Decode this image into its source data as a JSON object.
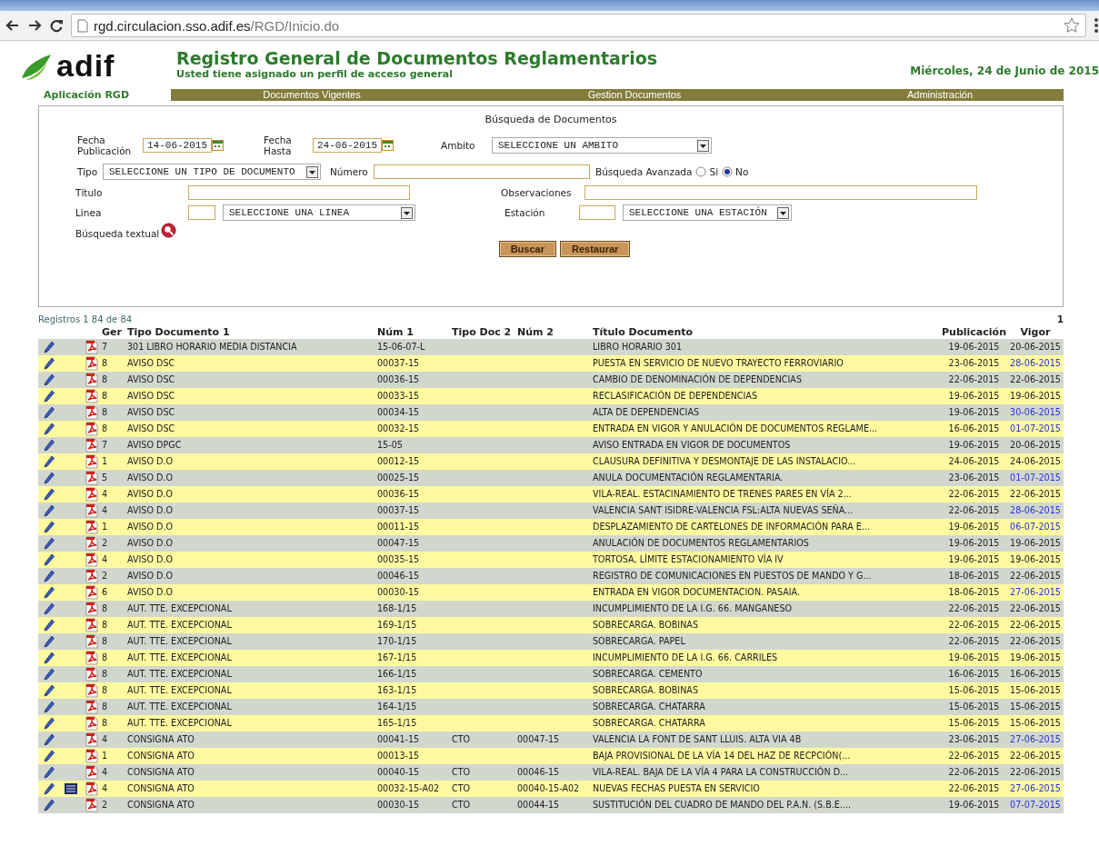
{
  "browser": {
    "url_host": "rgd.circulacion.sso.adif.es",
    "url_path": "/RGD/Inicio.do"
  },
  "header": {
    "logo": "adif",
    "title": "Registro General de Documentos Reglamentarios",
    "subtitle": "Usted tiene asignado un perfil de acceso general",
    "date": "Miércoles, 24 de Junio de 2015",
    "app_label": "Aplicación RGD",
    "menu": [
      "Documentos Vigentes",
      "Gestion Documentos",
      "Administración"
    ]
  },
  "search": {
    "title": "Búsqueda de Documentos",
    "fecha_publicacion": {
      "label": "Fecha Publicación",
      "value": "14-06-2015"
    },
    "fecha_hasta": {
      "label": "Fecha Hasta",
      "value": "24-06-2015"
    },
    "ambito": {
      "label": "Ambito",
      "value": "SELECCIONE UN AMBITO"
    },
    "tipo": {
      "label": "Tipo",
      "value": "SELECCIONE UN TIPO DE DOCUMENTO"
    },
    "numero": {
      "label": "Número"
    },
    "avanzada": {
      "label": "Búsqueda Avanzada",
      "options": [
        {
          "label": "Si",
          "selected": false
        },
        {
          "label": "No",
          "selected": true
        }
      ]
    },
    "titulo": {
      "label": "Título"
    },
    "observaciones": {
      "label": "Observaciones"
    },
    "linea": {
      "label": "Linea",
      "value": "SELECCIONE UNA LINEA"
    },
    "estacion": {
      "label": "Estación",
      "value": "SELECCIONE UNA ESTACIÓN"
    },
    "textual": {
      "label": "Búsqueda textual"
    },
    "buttons": [
      "Buscar",
      "Restaurar"
    ]
  },
  "results": {
    "count": "Registros 1 84 de 84",
    "page": "1",
    "columns": [
      "Ger",
      "Tipo Documento 1",
      "Núm 1",
      "Tipo Doc 2",
      "Núm 2",
      "Título Documento",
      "Publicación",
      "Vigor"
    ],
    "rows": [
      {
        "ger": "7",
        "tipo1": "301 LIBRO HORARIO MEDIA DISTANCIA",
        "num1": "15-06-07-L",
        "titulo": "LIBRO HORARIO 301",
        "publicacion": "19-06-2015",
        "vigor": "20-06-2015",
        "vigor_pending": false,
        "detail": false
      },
      {
        "ger": "8",
        "tipo1": "AVISO DSC",
        "num1": "00037-15",
        "titulo": "PUESTA EN SERVICIO DE NUEVO TRAYECTO FERROVIARIO",
        "publicacion": "23-06-2015",
        "vigor": "28-06-2015",
        "vigor_pending": true,
        "detail": false
      },
      {
        "ger": "8",
        "tipo1": "AVISO DSC",
        "num1": "00036-15",
        "titulo": "CAMBIO DE DENOMINACIÓN DE DEPENDENCIAS",
        "publicacion": "22-06-2015",
        "vigor": "22-06-2015",
        "vigor_pending": false,
        "detail": false
      },
      {
        "ger": "8",
        "tipo1": "AVISO DSC",
        "num1": "00033-15",
        "titulo": "RECLASIFICACIÓN DE DEPENDENCIAS",
        "publicacion": "19-06-2015",
        "vigor": "19-06-2015",
        "vigor_pending": false,
        "detail": false
      },
      {
        "ger": "8",
        "tipo1": "AVISO DSC",
        "num1": "00034-15",
        "titulo": "ALTA DE DEPENDENCIAS",
        "publicacion": "19-06-2015",
        "vigor": "30-06-2015",
        "vigor_pending": true,
        "detail": false
      },
      {
        "ger": "8",
        "tipo1": "AVISO DSC",
        "num1": "00032-15",
        "titulo": "ENTRADA EN VIGOR Y ANULACIÓN DE DOCUMENTOS REGLAME...",
        "publicacion": "16-06-2015",
        "vigor": "01-07-2015",
        "vigor_pending": true,
        "detail": false
      },
      {
        "ger": "7",
        "tipo1": "AVISO DPGC",
        "num1": "15-05",
        "titulo": "AVISO ENTRADA EN VIGOR DE DOCUMENTOS",
        "publicacion": "19-06-2015",
        "vigor": "20-06-2015",
        "vigor_pending": false,
        "detail": false
      },
      {
        "ger": "1",
        "tipo1": "AVISO D.O",
        "num1": "00012-15",
        "titulo": "CLAUSURA DEFINITIVA Y DESMONTAJE DE LAS INSTALACIO...",
        "publicacion": "24-06-2015",
        "vigor": "24-06-2015",
        "vigor_pending": false,
        "detail": false
      },
      {
        "ger": "5",
        "tipo1": "AVISO D.O",
        "num1": "00025-15",
        "titulo": "ANULA DOCUMENTACIÓN REGLAMENTARIA.",
        "publicacion": "23-06-2015",
        "vigor": "01-07-2015",
        "vigor_pending": true,
        "detail": false
      },
      {
        "ger": "4",
        "tipo1": "AVISO D.O",
        "num1": "00036-15",
        "titulo": "VILA-REAL. ESTACINAMIENTO DE TRENES PARES EN VÍA 2...",
        "publicacion": "22-06-2015",
        "vigor": "22-06-2015",
        "vigor_pending": false,
        "detail": false
      },
      {
        "ger": "4",
        "tipo1": "AVISO D.O",
        "num1": "00037-15",
        "titulo": "VALENCIA SANT ISIDRE-VALENCIA FSL:ALTA NUEVAS SEÑA...",
        "publicacion": "22-06-2015",
        "vigor": "28-06-2015",
        "vigor_pending": true,
        "detail": false
      },
      {
        "ger": "1",
        "tipo1": "AVISO D.O",
        "num1": "00011-15",
        "titulo": "DESPLAZAMIENTO DE CARTELONES DE INFORMACIÓN PARA E...",
        "publicacion": "19-06-2015",
        "vigor": "06-07-2015",
        "vigor_pending": true,
        "detail": false
      },
      {
        "ger": "2",
        "tipo1": "AVISO D.O",
        "num1": "00047-15",
        "titulo": "ANULACIÓN DE DOCUMENTOS REGLAMENTARIOS",
        "publicacion": "19-06-2015",
        "vigor": "19-06-2015",
        "vigor_pending": false,
        "detail": false
      },
      {
        "ger": "4",
        "tipo1": "AVISO D.O",
        "num1": "00035-15",
        "titulo": "TORTOSA, LÍMITE ESTACIONAMIENTO VÍA IV",
        "publicacion": "19-06-2015",
        "vigor": "19-06-2015",
        "vigor_pending": false,
        "detail": false
      },
      {
        "ger": "2",
        "tipo1": "AVISO D.O",
        "num1": "00046-15",
        "titulo": "REGISTRO DE COMUNICACIONES EN PUESTOS DE MANDO Y G...",
        "publicacion": "18-06-2015",
        "vigor": "22-06-2015",
        "vigor_pending": false,
        "detail": false
      },
      {
        "ger": "6",
        "tipo1": "AVISO D.O",
        "num1": "00030-15",
        "titulo": "ENTRADA EN VIGOR DOCUMENTACION. PASAIA.",
        "publicacion": "18-06-2015",
        "vigor": "27-06-2015",
        "vigor_pending": true,
        "detail": false
      },
      {
        "ger": "8",
        "tipo1": "AUT. TTE. EXCEPCIONAL",
        "num1": "168-1/15",
        "titulo": "INCUMPLIMIENTO DE LA I.G. 66. MANGANESO",
        "publicacion": "22-06-2015",
        "vigor": "22-06-2015",
        "vigor_pending": false,
        "detail": false
      },
      {
        "ger": "8",
        "tipo1": "AUT. TTE. EXCEPCIONAL",
        "num1": "169-1/15",
        "titulo": "SOBRECARGA. BOBINAS",
        "publicacion": "22-06-2015",
        "vigor": "22-06-2015",
        "vigor_pending": false,
        "detail": false
      },
      {
        "ger": "8",
        "tipo1": "AUT. TTE. EXCEPCIONAL",
        "num1": "170-1/15",
        "titulo": "SOBRECARGA. PAPEL",
        "publicacion": "22-06-2015",
        "vigor": "22-06-2015",
        "vigor_pending": false,
        "detail": false
      },
      {
        "ger": "8",
        "tipo1": "AUT. TTE. EXCEPCIONAL",
        "num1": "167-1/15",
        "titulo": "INCUMPLIMIENTO DE LA I.G. 66. CARRILES",
        "publicacion": "19-06-2015",
        "vigor": "19-06-2015",
        "vigor_pending": false,
        "detail": false
      },
      {
        "ger": "8",
        "tipo1": "AUT. TTE. EXCEPCIONAL",
        "num1": "166-1/15",
        "titulo": "SOBRECARGA. CEMENTO",
        "publicacion": "16-06-2015",
        "vigor": "16-06-2015",
        "vigor_pending": false,
        "detail": false
      },
      {
        "ger": "8",
        "tipo1": "AUT. TTE. EXCEPCIONAL",
        "num1": "163-1/15",
        "titulo": "SOBRECARGA. BOBINAS",
        "publicacion": "15-06-2015",
        "vigor": "15-06-2015",
        "vigor_pending": false,
        "detail": false
      },
      {
        "ger": "8",
        "tipo1": "AUT. TTE. EXCEPCIONAL",
        "num1": "164-1/15",
        "titulo": "SOBRECARGA. CHATARRA",
        "publicacion": "15-06-2015",
        "vigor": "15-06-2015",
        "vigor_pending": false,
        "detail": false
      },
      {
        "ger": "8",
        "tipo1": "AUT. TTE. EXCEPCIONAL",
        "num1": "165-1/15",
        "titulo": "SOBRECARGA. CHATARRA",
        "publicacion": "15-06-2015",
        "vigor": "15-06-2015",
        "vigor_pending": false,
        "detail": false
      },
      {
        "ger": "4",
        "tipo1": "CONSIGNA ATO",
        "num1": "00041-15",
        "tipo2": "CTO",
        "num2": "00047-15",
        "titulo": "VALENCIA LA FONT DE SANT LLUIS. ALTA VIA 4B",
        "publicacion": "23-06-2015",
        "vigor": "27-06-2015",
        "vigor_pending": true,
        "detail": false
      },
      {
        "ger": "1",
        "tipo1": "CONSIGNA ATO",
        "num1": "00013-15",
        "titulo": "BAJA PROVISIONAL DE LA VÍA 14 DEL HAZ DE RECPCIÓN(...",
        "publicacion": "22-06-2015",
        "vigor": "22-06-2015",
        "vigor_pending": false,
        "detail": false
      },
      {
        "ger": "4",
        "tipo1": "CONSIGNA ATO",
        "num1": "00040-15",
        "tipo2": "CTO",
        "num2": "00046-15",
        "titulo": "VILA-REAL. BAJA DE LA VÍA 4 PARA LA CONSTRUCCIÓN D...",
        "publicacion": "22-06-2015",
        "vigor": "22-06-2015",
        "vigor_pending": false,
        "detail": false
      },
      {
        "ger": "4",
        "tipo1": "CONSIGNA ATO",
        "num1": "00032-15-A02",
        "tipo2": "CTO",
        "num2": "00040-15-A02",
        "titulo": "NUEVAS FECHAS PUESTA EN SERVICIO",
        "publicacion": "22-06-2015",
        "vigor": "27-06-2015",
        "vigor_pending": true,
        "detail": true
      },
      {
        "ger": "2",
        "tipo1": "CONSIGNA ATO",
        "num1": "00030-15",
        "tipo2": "CTO",
        "num2": "00044-15",
        "titulo": "SUSTITUCIÓN DEL CUADRO DE MANDO DEL P.A.N. (S.B.E....",
        "publicacion": "19-06-2015",
        "vigor": "07-07-2015",
        "vigor_pending": true,
        "detail": false
      }
    ]
  }
}
